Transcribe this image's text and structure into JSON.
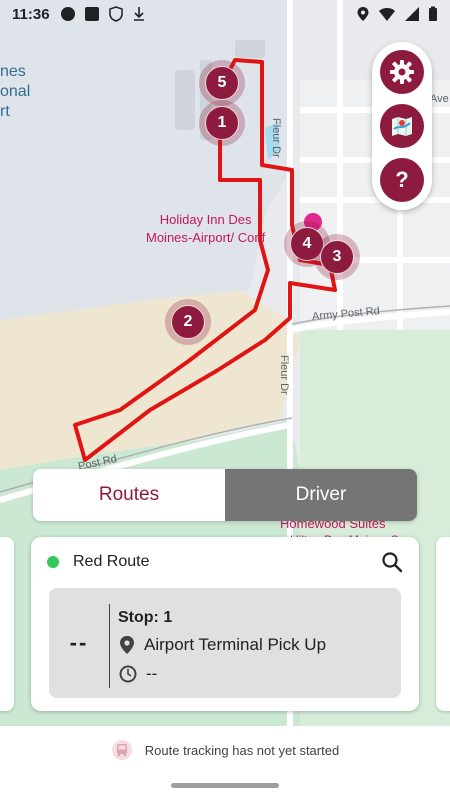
{
  "status_bar": {
    "time": "11:36",
    "left_icons": [
      "circle-notification-icon",
      "square-notification-icon",
      "shield-icon",
      "download-icon"
    ],
    "right_icons": [
      "location-icon",
      "wifi-icon",
      "signal-icon",
      "battery-icon"
    ]
  },
  "map": {
    "airport_label_lines": [
      "nes",
      "onal",
      "rt"
    ],
    "poi_label_lines": [
      "Holiday Inn Des",
      "Moines-Airport/ Conf"
    ],
    "streets": {
      "fleur_dr_top": "Fleur Dr",
      "fleur_dr_bottom": "Fleur Dr",
      "army_post_rd": "Army Post Rd",
      "post_rd": "Post Rd",
      "ave": "Ave",
      "homewood": "Homewood Suites",
      "homewood_sub": "Hilton Des Moines S..."
    },
    "route_color": "#e11414",
    "markers": [
      {
        "id": "marker-5",
        "label": "5"
      },
      {
        "id": "marker-1",
        "label": "1"
      },
      {
        "id": "marker-4",
        "label": "4"
      },
      {
        "id": "marker-3",
        "label": "3"
      },
      {
        "id": "marker-2",
        "label": "2"
      }
    ]
  },
  "fab": {
    "settings_icon": "gear-icon",
    "map_icon": "map-icon",
    "help_icon": "question-icon"
  },
  "toggle": {
    "routes_label": "Routes",
    "driver_label": "Driver",
    "active": "Routes"
  },
  "route_card": {
    "route_name": "Red Route",
    "status_color": "#34c759",
    "pages_total": 4,
    "page_active": 1,
    "eta": "--",
    "stop_title": "Stop: 1",
    "stop_name": "Airport Terminal Pick Up",
    "stop_time": "--"
  },
  "footer": {
    "message": "Route tracking has not yet started",
    "icon": "bus-icon"
  },
  "colors": {
    "brand": "#8d1b3d",
    "driver_tab": "#757575"
  }
}
